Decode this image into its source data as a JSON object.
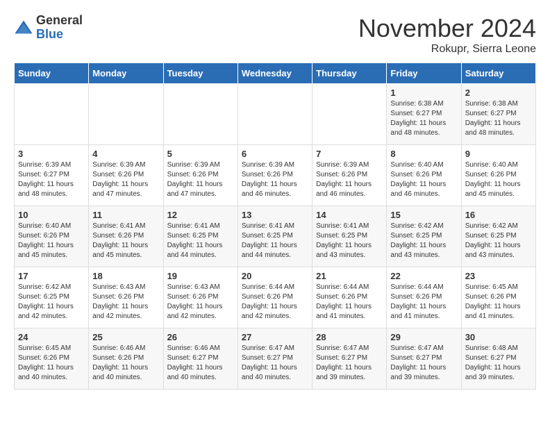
{
  "logo": {
    "general": "General",
    "blue": "Blue"
  },
  "title": "November 2024",
  "subtitle": "Rokupr, Sierra Leone",
  "days_header": [
    "Sunday",
    "Monday",
    "Tuesday",
    "Wednesday",
    "Thursday",
    "Friday",
    "Saturday"
  ],
  "weeks": [
    [
      {
        "day": "",
        "info": ""
      },
      {
        "day": "",
        "info": ""
      },
      {
        "day": "",
        "info": ""
      },
      {
        "day": "",
        "info": ""
      },
      {
        "day": "",
        "info": ""
      },
      {
        "day": "1",
        "info": "Sunrise: 6:38 AM\nSunset: 6:27 PM\nDaylight: 11 hours\nand 48 minutes."
      },
      {
        "day": "2",
        "info": "Sunrise: 6:38 AM\nSunset: 6:27 PM\nDaylight: 11 hours\nand 48 minutes."
      }
    ],
    [
      {
        "day": "3",
        "info": "Sunrise: 6:39 AM\nSunset: 6:27 PM\nDaylight: 11 hours\nand 48 minutes."
      },
      {
        "day": "4",
        "info": "Sunrise: 6:39 AM\nSunset: 6:26 PM\nDaylight: 11 hours\nand 47 minutes."
      },
      {
        "day": "5",
        "info": "Sunrise: 6:39 AM\nSunset: 6:26 PM\nDaylight: 11 hours\nand 47 minutes."
      },
      {
        "day": "6",
        "info": "Sunrise: 6:39 AM\nSunset: 6:26 PM\nDaylight: 11 hours\nand 46 minutes."
      },
      {
        "day": "7",
        "info": "Sunrise: 6:39 AM\nSunset: 6:26 PM\nDaylight: 11 hours\nand 46 minutes."
      },
      {
        "day": "8",
        "info": "Sunrise: 6:40 AM\nSunset: 6:26 PM\nDaylight: 11 hours\nand 46 minutes."
      },
      {
        "day": "9",
        "info": "Sunrise: 6:40 AM\nSunset: 6:26 PM\nDaylight: 11 hours\nand 45 minutes."
      }
    ],
    [
      {
        "day": "10",
        "info": "Sunrise: 6:40 AM\nSunset: 6:26 PM\nDaylight: 11 hours\nand 45 minutes."
      },
      {
        "day": "11",
        "info": "Sunrise: 6:41 AM\nSunset: 6:26 PM\nDaylight: 11 hours\nand 45 minutes."
      },
      {
        "day": "12",
        "info": "Sunrise: 6:41 AM\nSunset: 6:25 PM\nDaylight: 11 hours\nand 44 minutes."
      },
      {
        "day": "13",
        "info": "Sunrise: 6:41 AM\nSunset: 6:25 PM\nDaylight: 11 hours\nand 44 minutes."
      },
      {
        "day": "14",
        "info": "Sunrise: 6:41 AM\nSunset: 6:25 PM\nDaylight: 11 hours\nand 43 minutes."
      },
      {
        "day": "15",
        "info": "Sunrise: 6:42 AM\nSunset: 6:25 PM\nDaylight: 11 hours\nand 43 minutes."
      },
      {
        "day": "16",
        "info": "Sunrise: 6:42 AM\nSunset: 6:25 PM\nDaylight: 11 hours\nand 43 minutes."
      }
    ],
    [
      {
        "day": "17",
        "info": "Sunrise: 6:42 AM\nSunset: 6:25 PM\nDaylight: 11 hours\nand 42 minutes."
      },
      {
        "day": "18",
        "info": "Sunrise: 6:43 AM\nSunset: 6:26 PM\nDaylight: 11 hours\nand 42 minutes."
      },
      {
        "day": "19",
        "info": "Sunrise: 6:43 AM\nSunset: 6:26 PM\nDaylight: 11 hours\nand 42 minutes."
      },
      {
        "day": "20",
        "info": "Sunrise: 6:44 AM\nSunset: 6:26 PM\nDaylight: 11 hours\nand 42 minutes."
      },
      {
        "day": "21",
        "info": "Sunrise: 6:44 AM\nSunset: 6:26 PM\nDaylight: 11 hours\nand 41 minutes."
      },
      {
        "day": "22",
        "info": "Sunrise: 6:44 AM\nSunset: 6:26 PM\nDaylight: 11 hours\nand 41 minutes."
      },
      {
        "day": "23",
        "info": "Sunrise: 6:45 AM\nSunset: 6:26 PM\nDaylight: 11 hours\nand 41 minutes."
      }
    ],
    [
      {
        "day": "24",
        "info": "Sunrise: 6:45 AM\nSunset: 6:26 PM\nDaylight: 11 hours\nand 40 minutes."
      },
      {
        "day": "25",
        "info": "Sunrise: 6:46 AM\nSunset: 6:26 PM\nDaylight: 11 hours\nand 40 minutes."
      },
      {
        "day": "26",
        "info": "Sunrise: 6:46 AM\nSunset: 6:27 PM\nDaylight: 11 hours\nand 40 minutes."
      },
      {
        "day": "27",
        "info": "Sunrise: 6:47 AM\nSunset: 6:27 PM\nDaylight: 11 hours\nand 40 minutes."
      },
      {
        "day": "28",
        "info": "Sunrise: 6:47 AM\nSunset: 6:27 PM\nDaylight: 11 hours\nand 39 minutes."
      },
      {
        "day": "29",
        "info": "Sunrise: 6:47 AM\nSunset: 6:27 PM\nDaylight: 11 hours\nand 39 minutes."
      },
      {
        "day": "30",
        "info": "Sunrise: 6:48 AM\nSunset: 6:27 PM\nDaylight: 11 hours\nand 39 minutes."
      }
    ]
  ]
}
